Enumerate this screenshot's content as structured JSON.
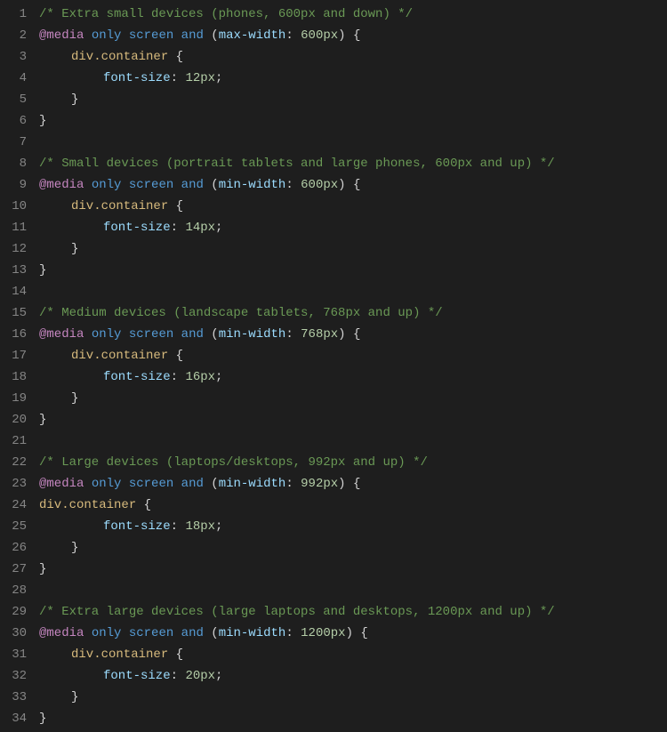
{
  "lineCount": 34,
  "blocks": [
    {
      "comment": "/* Extra small devices (phones, 600px and down) */",
      "media": {
        "prop": "max-width",
        "val": "600px"
      },
      "selectorIndent": 1,
      "rule": {
        "prop": "font-size",
        "val": "12px"
      }
    },
    {
      "comment": "/* Small devices (portrait tablets and large phones, 600px and up) */",
      "media": {
        "prop": "min-width",
        "val": "600px"
      },
      "selectorIndent": 1,
      "rule": {
        "prop": "font-size",
        "val": "14px"
      }
    },
    {
      "comment": "/* Medium devices (landscape tablets, 768px and up) */",
      "media": {
        "prop": "min-width",
        "val": "768px"
      },
      "selectorIndent": 1,
      "rule": {
        "prop": "font-size",
        "val": "16px"
      }
    },
    {
      "comment": "/* Large devices (laptops/desktops, 992px and up) */",
      "media": {
        "prop": "min-width",
        "val": "992px"
      },
      "selectorIndent": 0,
      "rule": {
        "prop": "font-size",
        "val": "18px"
      }
    },
    {
      "comment": "/* Extra large devices (large laptops and desktops, 1200px and up) */",
      "media": {
        "prop": "min-width",
        "val": "1200px"
      },
      "selectorIndent": 1,
      "rule": {
        "prop": "font-size",
        "val": "20px"
      }
    }
  ],
  "tokens": {
    "atMedia": "@media",
    "only": "only",
    "screen": "screen",
    "and": "and",
    "selector": "div.container",
    "openBrace": "{",
    "closeBrace": "}",
    "colon": ":",
    "semicolon": ";",
    "openParen": "(",
    "closeParen": ")"
  }
}
